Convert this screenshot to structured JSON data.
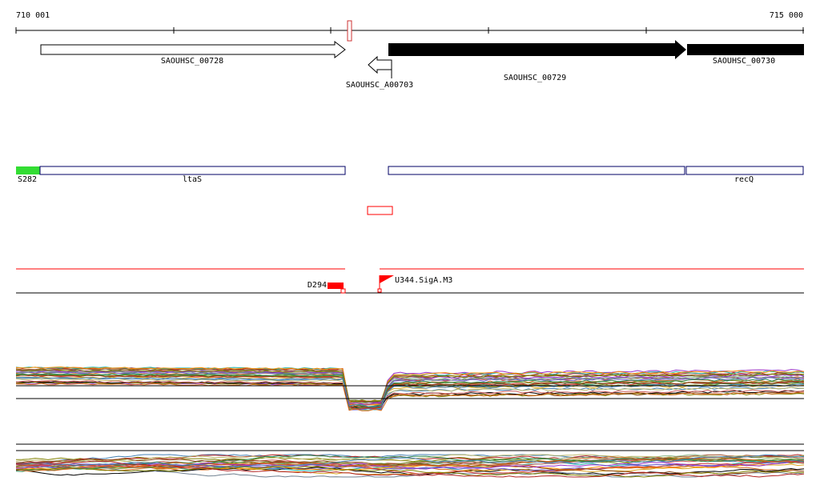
{
  "axis": {
    "start_label": "710 001",
    "end_label": "715 000"
  },
  "genes": [
    {
      "name": "SAOUHSC_00728",
      "strand": "+",
      "fill": "#ffffff"
    },
    {
      "name": "SAOUHSC_A00703",
      "strand": "-",
      "fill": "#ffffff"
    },
    {
      "name": "SAOUHSC_00729",
      "strand": "+",
      "fill": "#000000"
    },
    {
      "name": "SAOUHSC_00730",
      "strand": "+",
      "fill": "#000000"
    }
  ],
  "features": [
    {
      "name": "S282",
      "color": "#33dd33"
    },
    {
      "name": "ltaS"
    },
    {
      "name": "recQ"
    }
  ],
  "markers": {
    "left": "D294",
    "right": "U344.SigA.M3"
  },
  "colors": {
    "feature_border": "#000066",
    "marker": "#ff0000",
    "signal": "#ff0000"
  },
  "icons": [
    "marker-flag-icon",
    "marker-box-icon"
  ]
}
